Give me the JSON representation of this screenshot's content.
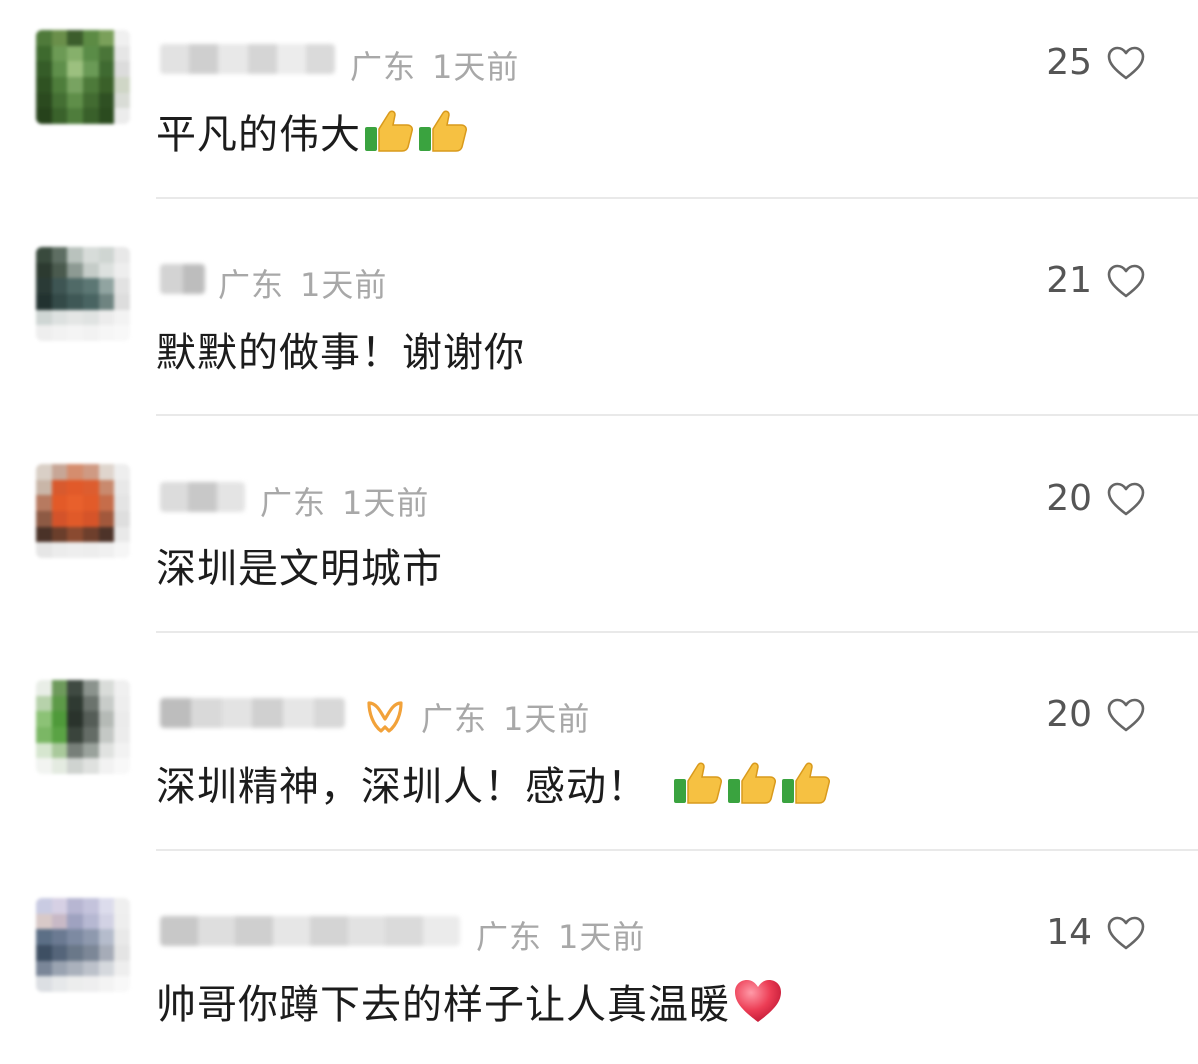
{
  "comments": [
    {
      "location": "广东",
      "time": "1天前",
      "text": "平凡的伟大",
      "likes": "25",
      "emojis": [
        "thumbs-up",
        "thumbs-up"
      ]
    },
    {
      "location": "广东",
      "time": "1天前",
      "text": "默默的做事！谢谢你",
      "likes": "21",
      "emojis": []
    },
    {
      "location": "广东",
      "time": "1天前",
      "text": "深圳是文明城市",
      "likes": "20",
      "emojis": []
    },
    {
      "location": "广东",
      "time": "1天前",
      "text": "深圳精神，深圳人！感动！",
      "likes": "20",
      "emojis": [
        "thumbs-up",
        "thumbs-up",
        "thumbs-up"
      ],
      "badge": "vip-ribbon-icon"
    },
    {
      "location": "广东",
      "time": "1天前",
      "text": "帅哥你蹲下去的样子让人真温暖",
      "likes": "14",
      "emojis": [
        "red-heart"
      ]
    }
  ],
  "colors": {
    "meta_text": "#a8a8a8",
    "like_count": "#555555",
    "divider": "#e9e9e9",
    "badge_accent": "#f2a23a"
  }
}
